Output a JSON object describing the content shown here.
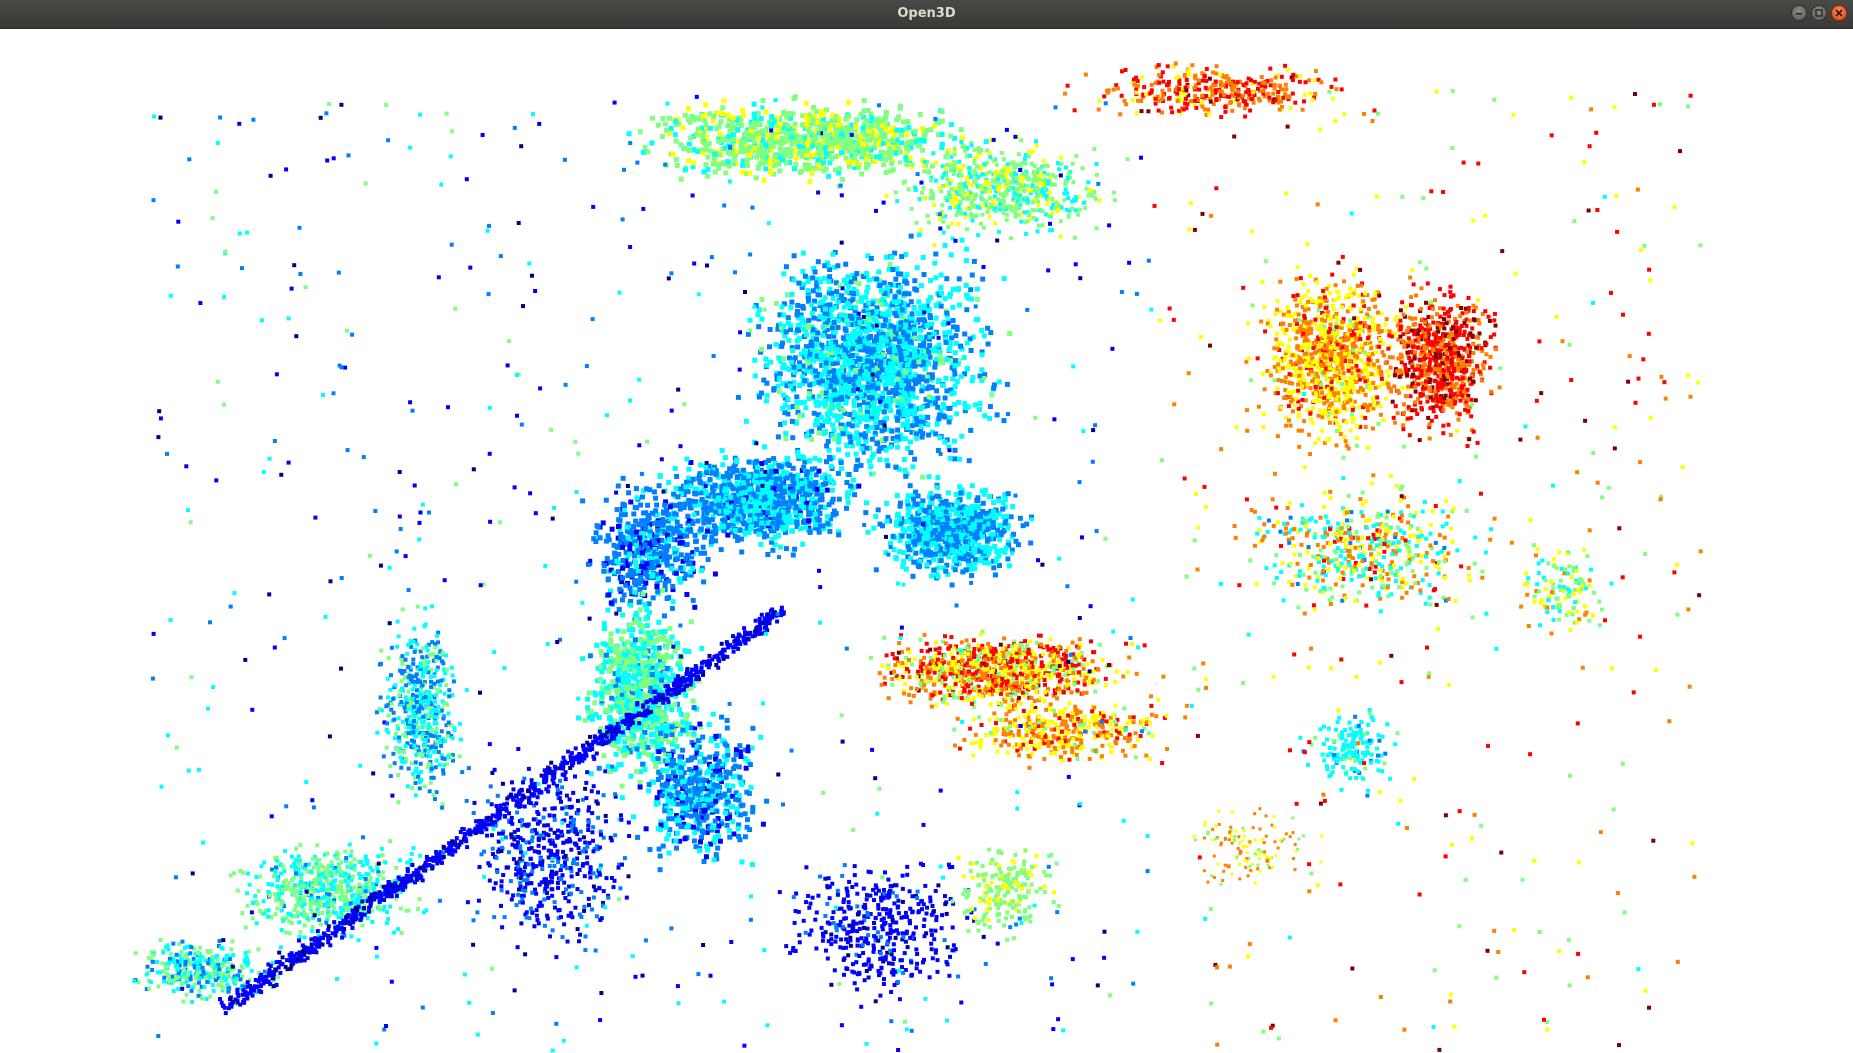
{
  "window": {
    "title": "Open3D",
    "controls": {
      "minimize_icon": "minimize-icon",
      "maximize_icon": "maximize-icon",
      "close_icon": "close-icon"
    }
  },
  "viewer": {
    "content": "point-cloud",
    "colormap": [
      "#00008f",
      "#0000ff",
      "#0080ff",
      "#00ffff",
      "#80ff80",
      "#ffff00",
      "#ff8000",
      "#ff0000",
      "#800000"
    ],
    "background": "#ffffff"
  }
}
